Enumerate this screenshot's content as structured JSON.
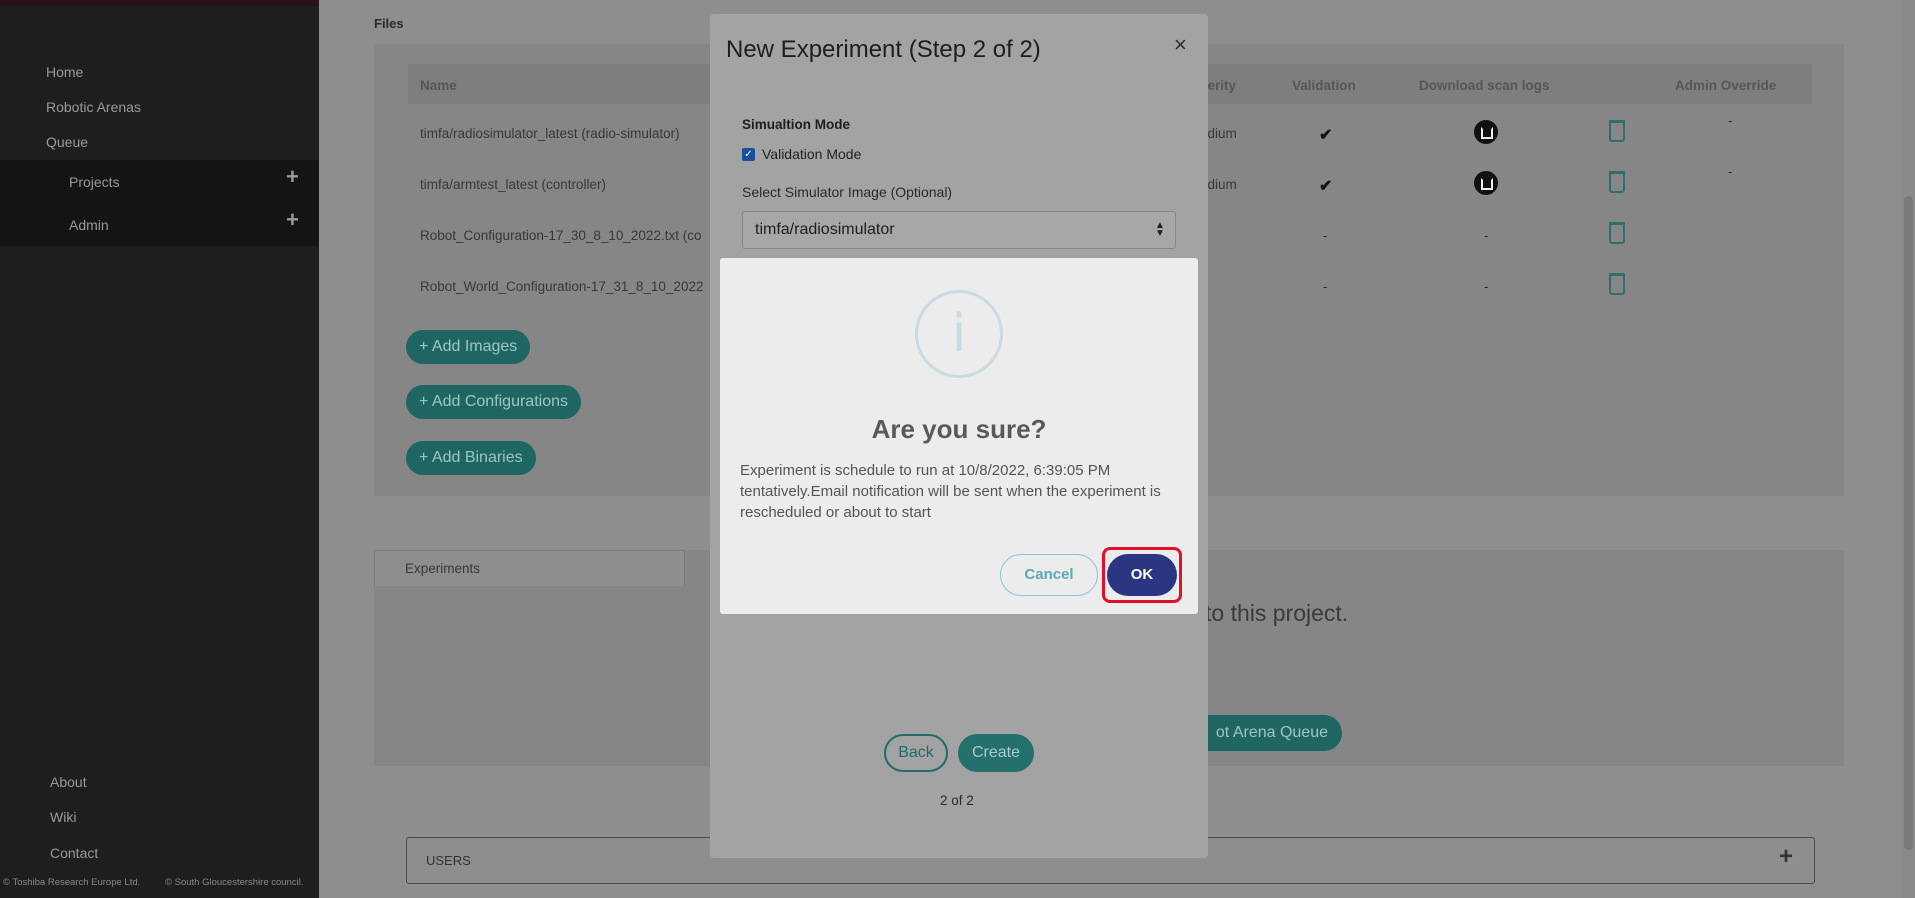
{
  "sidebar": {
    "nav": [
      "Home",
      "Robotic Arenas",
      "Queue"
    ],
    "sub": [
      "Projects",
      "Admin"
    ],
    "plus": "+",
    "footer": [
      "About",
      "Wiki",
      "Contact"
    ],
    "copyright_left": "© Toshiba Research Europe Ltd.",
    "copyright_right": "© South Gloucestershire council."
  },
  "files": {
    "title": "Files",
    "headers": [
      "Name",
      "verity",
      "Validation",
      "Download scan logs",
      "Admin Override"
    ],
    "rows": [
      {
        "name": "timfa/radiosimulator_latest (radio-simulator)",
        "severity": "edium",
        "validation": "✔",
        "override": "-"
      },
      {
        "name": "timfa/armtest_latest (controller)",
        "severity": "edium",
        "validation": "✔",
        "override": "-"
      },
      {
        "name": "Robot_Configuration-17_30_8_10_2022.txt (co",
        "severity": "-",
        "validation": "-",
        "download": "-"
      },
      {
        "name": "Robot_World_Configuration-17_31_8_10_2022",
        "severity": "-",
        "validation": "-",
        "download": "-"
      }
    ],
    "buttons": [
      "+ Add Images",
      "+ Add Configurations",
      "+ Add Binaries"
    ]
  },
  "experiments": {
    "tab": "Experiments",
    "empty_text": "to this project.",
    "queue_button": "ot Arena Queue"
  },
  "users": {
    "label": "USERS",
    "plus": "+"
  },
  "wizard": {
    "title": "New Experiment (Step 2 of 2)",
    "close": "×",
    "sim_mode_label": "Simualtion Mode",
    "checkbox_mark": "✓",
    "validation_label": "Validation Mode",
    "select_label": "Select Simulator Image (Optional)",
    "select_value": "timfa/radiosimulator",
    "back": "Back",
    "create": "Create",
    "pager": "2 of 2"
  },
  "dialog": {
    "icon_glyph": "i",
    "title": "Are you sure?",
    "message": "Experiment is schedule to run at 10/8/2022, 6:39:05 PM tentatively.Email notification will be sent when the experiment is rescheduled or about to start",
    "cancel": "Cancel",
    "ok": "OK"
  },
  "colors": {
    "accent_teal": "#1f6663",
    "ok_button": "#2c3582",
    "highlight": "#e0102a"
  }
}
